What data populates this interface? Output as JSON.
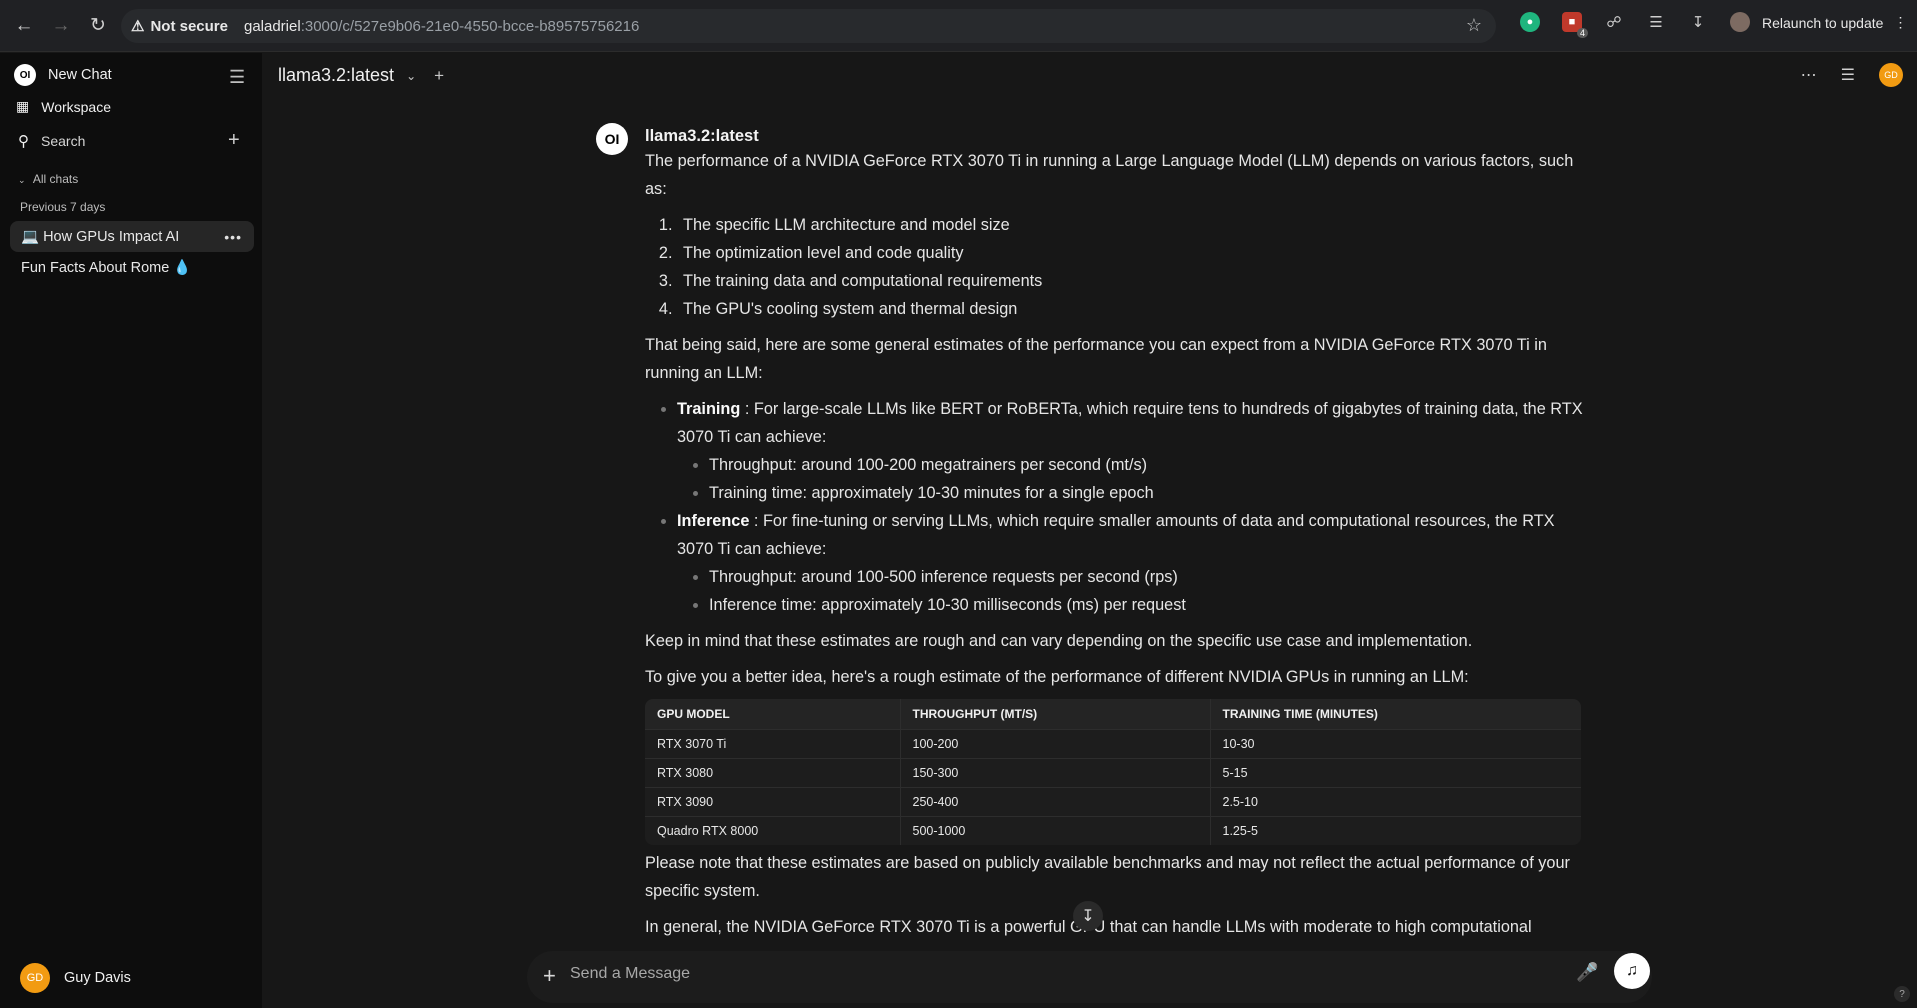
{
  "browser": {
    "security_label": "Not secure",
    "url_host": "galadriel",
    "url_rest": ":3000/c/527e9b06-21e0-4550-bcce-b89575756216",
    "extension_badge_count": "4",
    "relaunch_label": "Relaunch to update"
  },
  "sidebar": {
    "new_chat_label": "New Chat",
    "logo_text": "OI",
    "workspace_label": "Workspace",
    "search_label": "Search",
    "all_chats_label": "All chats",
    "group_label": "Previous 7 days",
    "chats": [
      {
        "title": "💻 How GPUs Impact AI"
      },
      {
        "title": "Fun Facts About Rome 💧"
      }
    ],
    "user": {
      "initials": "GD",
      "name": "Guy Davis"
    }
  },
  "header": {
    "model_name": "llama3.2:latest",
    "user_initials": "GD"
  },
  "message": {
    "sender": "llama3.2:latest",
    "avatar_text": "OI",
    "intro": "The performance of a NVIDIA GeForce RTX 3070 Ti in running a Large Language Model (LLM) depends on various factors, such as:",
    "factors": [
      "The specific LLM architecture and model size",
      "The optimization level and code quality",
      "The training data and computational requirements",
      "The GPU's cooling system and thermal design"
    ],
    "estimates_intro": "That being said, here are some general estimates of the performance you can expect from a NVIDIA GeForce RTX 3070 Ti in running an LLM:",
    "training": {
      "label": "Training",
      "text": " : For large-scale LLMs like BERT or RoBERTa, which require tens to hundreds of gigabytes of training data, the RTX 3070 Ti can achieve:",
      "items": [
        "Throughput: around 100-200 megatrainers per second (mt/s)",
        "Training time: approximately 10-30 minutes for a single epoch"
      ]
    },
    "inference": {
      "label": "Inference",
      "text": " : For fine-tuning or serving LLMs, which require smaller amounts of data and computational resources, the RTX 3070 Ti can achieve:",
      "items": [
        "Throughput: around 100-500 inference requests per second (rps)",
        "Inference time: approximately 10-30 milliseconds (ms) per request"
      ]
    },
    "keep_in_mind": "Keep in mind that these estimates are rough and can vary depending on the specific use case and implementation.",
    "table_intro": "To give you a better idea, here's a rough estimate of the performance of different NVIDIA GPUs in running an LLM:",
    "table": {
      "headers": [
        "GPU MODEL",
        "THROUGHPUT (MT/S)",
        "TRAINING TIME (MINUTES)"
      ],
      "rows": [
        [
          "RTX 3070 Ti",
          "100-200",
          "10-30"
        ],
        [
          "RTX 3080",
          "150-300",
          "5-15"
        ],
        [
          "RTX 3090",
          "250-400",
          "2.5-10"
        ],
        [
          "Quadro RTX 8000",
          "500-1000",
          "1.25-5"
        ]
      ]
    },
    "note": "Please note that these estimates are based on publicly available benchmarks and may not reflect the actual performance of your specific system.",
    "conclusion": "In general, the NVIDIA GeForce RTX 3070 Ti is a powerful GPU that can handle LLMs with moderate to high computational"
  },
  "composer": {
    "placeholder": "Send a Message"
  },
  "colors": {
    "sidebar_bg": "#0d0d0d",
    "main_bg": "#171717",
    "avatar_accent": "#f29b12"
  }
}
